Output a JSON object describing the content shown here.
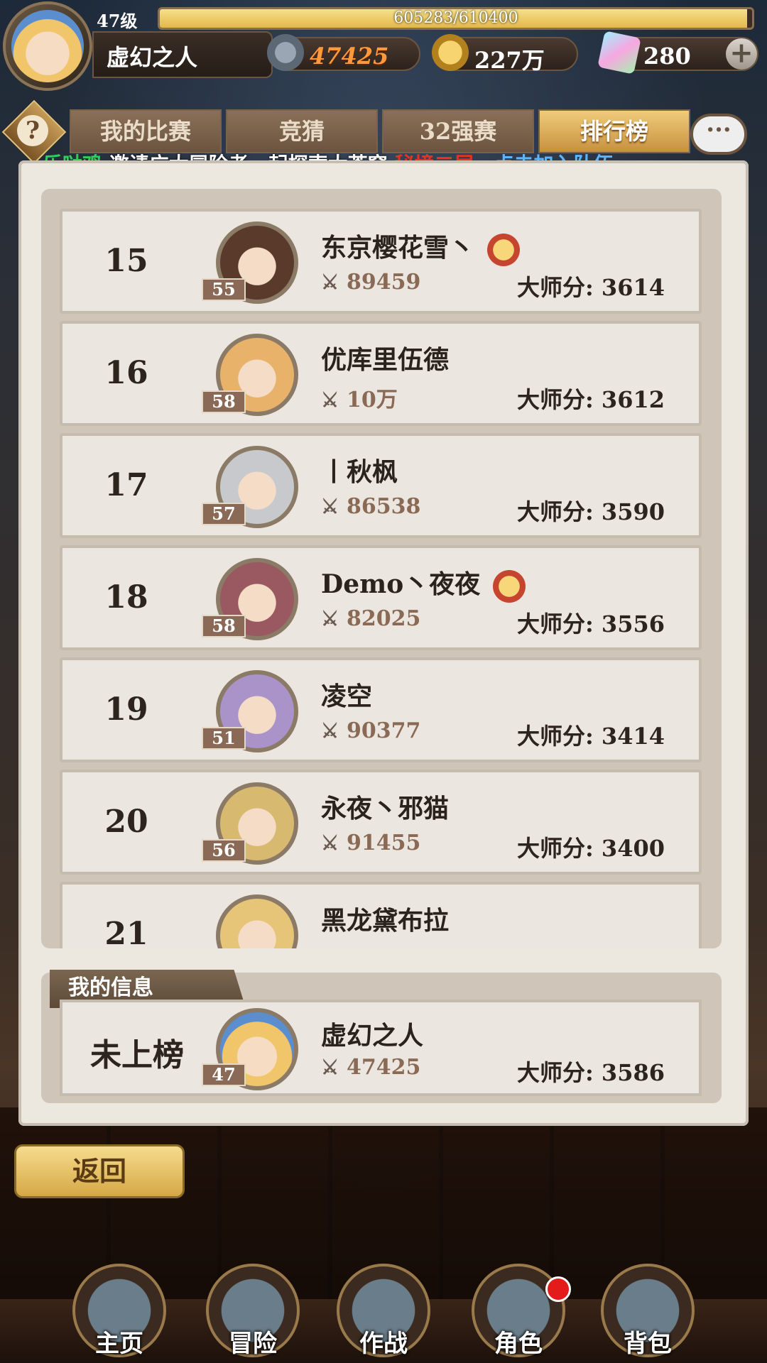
{
  "player": {
    "level_label": "47级",
    "xp_text": "605283/610400",
    "xp_progress": 0.9916,
    "name": "虚幻之人",
    "power": "47425",
    "gold": "227万",
    "gems": "280",
    "plus": "+"
  },
  "tabs": {
    "help": "?",
    "items": [
      {
        "label": "我的比赛"
      },
      {
        "label": "竞猜"
      },
      {
        "label": "32强赛"
      },
      {
        "label": "排行榜"
      }
    ],
    "active_index": 3,
    "chat": "···"
  },
  "announcement": {
    "who": "乐哒鸡",
    "msg": " 邀请广大冒险者一起探索大苍穹 ",
    "place": "秘境二层",
    "sep": "，",
    "link": "点击加入队伍",
    "end": "。"
  },
  "ranking": [
    {
      "rank": "15",
      "level": "55",
      "name": "东京樱花雪丶",
      "power": "89459",
      "score": "大师分: 3614",
      "badge": true,
      "avatar": "#5a3a2a"
    },
    {
      "rank": "16",
      "level": "58",
      "name": "优库里伍德",
      "power": "10万",
      "score": "大师分: 3612",
      "badge": false,
      "avatar": "#e9b26a"
    },
    {
      "rank": "17",
      "level": "57",
      "name": "丨秋枫",
      "power": "86538",
      "score": "大师分: 3590",
      "badge": false,
      "avatar": "#c7c9cc"
    },
    {
      "rank": "18",
      "level": "58",
      "name": "Demo丶夜夜",
      "power": "82025",
      "score": "大师分: 3556",
      "badge": true,
      "avatar": "#9a5860"
    },
    {
      "rank": "19",
      "level": "51",
      "name": "凌空",
      "power": "90377",
      "score": "大师分: 3414",
      "badge": false,
      "avatar": "#a993c8"
    },
    {
      "rank": "20",
      "level": "56",
      "name": "永夜丶邪猫",
      "power": "91455",
      "score": "大师分: 3400",
      "badge": false,
      "avatar": "#d8b970"
    },
    {
      "rank": "21",
      "level": "",
      "name": "黑龙黛布拉",
      "power": "",
      "score": "",
      "badge": false,
      "avatar": "#e6c478"
    }
  ],
  "my_info": {
    "title": "我的信息",
    "rank": "未上榜",
    "level": "47",
    "name": "虚幻之人",
    "power": "47425",
    "score": "大师分: 3586"
  },
  "back_button": "返回",
  "nav": [
    {
      "label": "主页"
    },
    {
      "label": "冒险"
    },
    {
      "label": "作战"
    },
    {
      "label": "角色"
    },
    {
      "label": "背包"
    }
  ],
  "icons": {
    "sword": "crossed-swords-icon",
    "coin": "gold-coin-icon",
    "gem": "crystal-gem-icon",
    "help": "question-icon",
    "chat": "chat-bubble-icon",
    "badge": "rank-medal-icon"
  }
}
